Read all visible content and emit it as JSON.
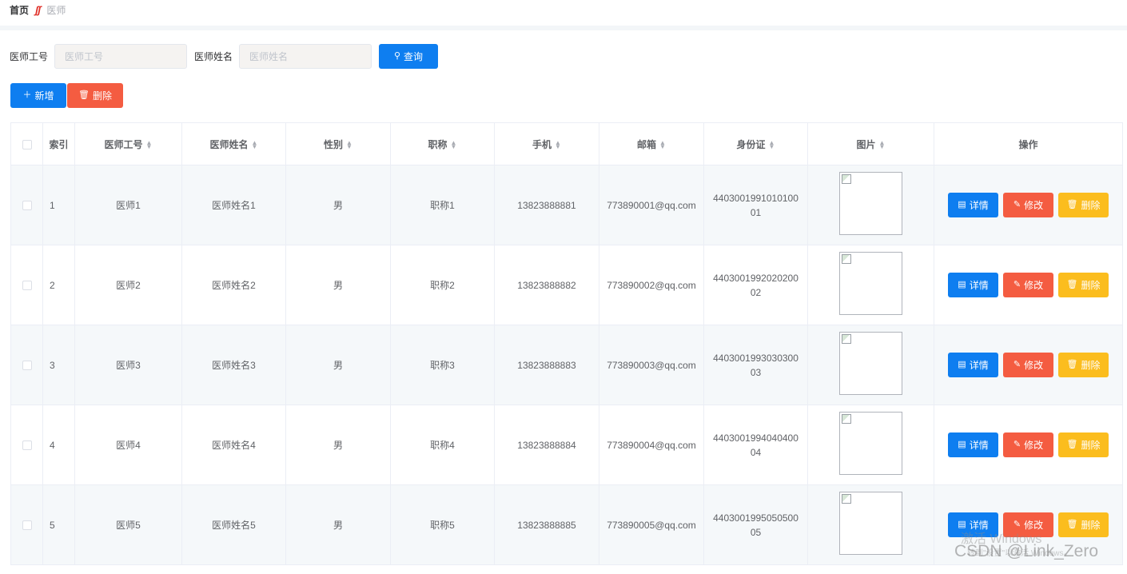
{
  "breadcrumb": {
    "home": "首页",
    "current": "医师"
  },
  "search": {
    "id_label": "医师工号",
    "id_placeholder": "医师工号",
    "name_label": "医师姓名",
    "name_placeholder": "医师姓名",
    "query_label": "查询"
  },
  "actions": {
    "add_label": "新增",
    "delete_label": "删除"
  },
  "table": {
    "headers": {
      "index": "索引",
      "doctor_id": "医师工号",
      "doctor_name": "医师姓名",
      "gender": "性别",
      "title": "职称",
      "phone": "手机",
      "email": "邮箱",
      "id_card": "身份证",
      "photo": "图片",
      "operation": "操作"
    },
    "row_buttons": {
      "detail": "详情",
      "edit": "修改",
      "delete": "删除"
    },
    "rows": [
      {
        "index": "1",
        "doctor_id": "医师1",
        "doctor_name": "医师姓名1",
        "gender": "男",
        "title": "职称1",
        "phone": "13823888881",
        "email": "773890001@qq.com",
        "id_card": "440300199101010001"
      },
      {
        "index": "2",
        "doctor_id": "医师2",
        "doctor_name": "医师姓名2",
        "gender": "男",
        "title": "职称2",
        "phone": "13823888882",
        "email": "773890002@qq.com",
        "id_card": "440300199202020002"
      },
      {
        "index": "3",
        "doctor_id": "医师3",
        "doctor_name": "医师姓名3",
        "gender": "男",
        "title": "职称3",
        "phone": "13823888883",
        "email": "773890003@qq.com",
        "id_card": "440300199303030003"
      },
      {
        "index": "4",
        "doctor_id": "医师4",
        "doctor_name": "医师姓名4",
        "gender": "男",
        "title": "职称4",
        "phone": "13823888884",
        "email": "773890004@qq.com",
        "id_card": "440300199404040004"
      },
      {
        "index": "5",
        "doctor_id": "医师5",
        "doctor_name": "医师姓名5",
        "gender": "男",
        "title": "职称5",
        "phone": "13823888885",
        "email": "773890005@qq.com",
        "id_card": "440300199505050005"
      }
    ]
  },
  "overlay": {
    "windows_line1": "激活 Windows",
    "windows_line2": "转到\"设置\"以激活 Windows。",
    "csdn": "CSDN @Link_Zero"
  },
  "colors": {
    "primary": "#0e7ef0",
    "danger": "#f45c41",
    "warning": "#fbbd1e"
  }
}
